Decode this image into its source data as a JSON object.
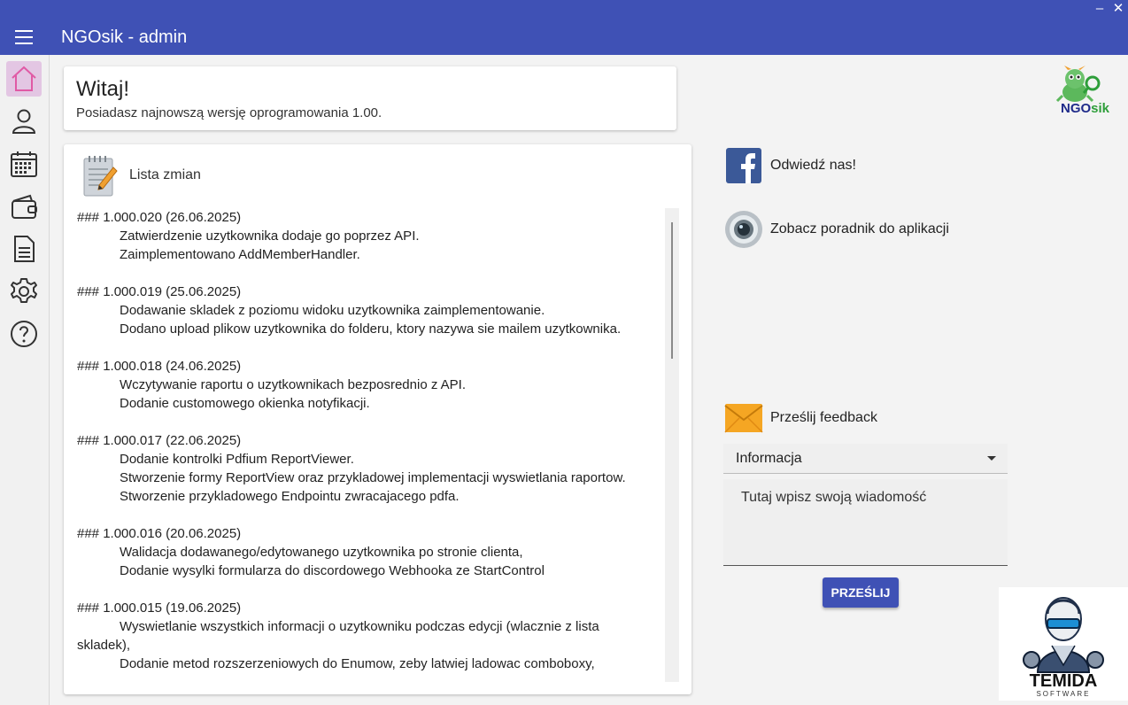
{
  "window": {
    "minimize_label": "–",
    "close_label": "✕"
  },
  "appbar": {
    "title": "NGOsik - admin",
    "menu_icon": "hamburger-menu-icon"
  },
  "sidebar": {
    "items": [
      {
        "icon": "home-icon",
        "active": true
      },
      {
        "icon": "user-icon",
        "active": false
      },
      {
        "icon": "calendar-icon",
        "active": false
      },
      {
        "icon": "wallet-icon",
        "active": false
      },
      {
        "icon": "document-icon",
        "active": false
      },
      {
        "icon": "gear-icon",
        "active": false
      },
      {
        "icon": "help-icon",
        "active": false
      }
    ]
  },
  "welcome": {
    "title": "Witaj!",
    "message": "Posiadasz najnowszą wersję oprogramowania 1.00."
  },
  "changelog": {
    "title": "Lista zmian",
    "versions": [
      {
        "header": "### 1.000.020 (26.06.2025)",
        "items": [
          "Zatwierdzenie uzytkownika dodaje go poprzez API.",
          "Zaimplementowano AddMemberHandler."
        ]
      },
      {
        "header": "### 1.000.019 (25.06.2025)",
        "items": [
          "Dodawanie skladek z poziomu widoku uzytkownika zaimplementowanie.",
          "Dodano upload plikow uzytkownika do folderu, ktory nazywa sie mailem uzytkownika."
        ]
      },
      {
        "header": "### 1.000.018 (24.06.2025)",
        "items": [
          "Wczytywanie raportu o uzytkownikach bezposrednio z API.",
          "Dodanie customowego okienka notyfikacji."
        ]
      },
      {
        "header": "### 1.000.017 (22.06.2025)",
        "items": [
          "Dodanie kontrolki Pdfium ReportViewer.",
          "Stworzenie formy ReportView oraz przykladowej implementacji wyswietlania raportow.",
          "Stworzenie przykladowego Endpointu zwracajacego pdfa."
        ]
      },
      {
        "header": "### 1.000.016 (20.06.2025)",
        "items": [
          "Walidacja dodawanego/edytowanego uzytkownika po stronie clienta,",
          "Dodanie wysylki formularza do discordowego Webhooka ze StartControl"
        ]
      },
      {
        "header": "### 1.000.015 (19.06.2025)",
        "items": [
          "Wyswietlanie wszystkich informacji o uzytkowniku podczas edycji (wlacznie z lista",
          "Dodanie metod rozszerzeniowych do Enumow, zeby latwiej ladowac comboboxy,"
        ],
        "wrap": "skladek),"
      }
    ]
  },
  "links": {
    "facebook_label": "Odwiedź nas!",
    "tutorial_label": "Zobacz poradnik do aplikacji"
  },
  "feedback": {
    "title": "Prześlij feedback",
    "type_value": "Informacja",
    "message_placeholder": "Tutaj wpisz swoją wiadomość",
    "submit_label": "PRZEŚLIJ"
  },
  "logos": {
    "ngosik_text_ngo": "NGO",
    "ngosik_text_sik": "sik",
    "temida_text": "TEMIDA",
    "temida_sub": "SOFTWARE"
  },
  "colors": {
    "primary": "#3f51b5",
    "active_nav": "#e3c6e3",
    "facebook": "#3b5998",
    "ngo_green": "#2e9e3a"
  }
}
